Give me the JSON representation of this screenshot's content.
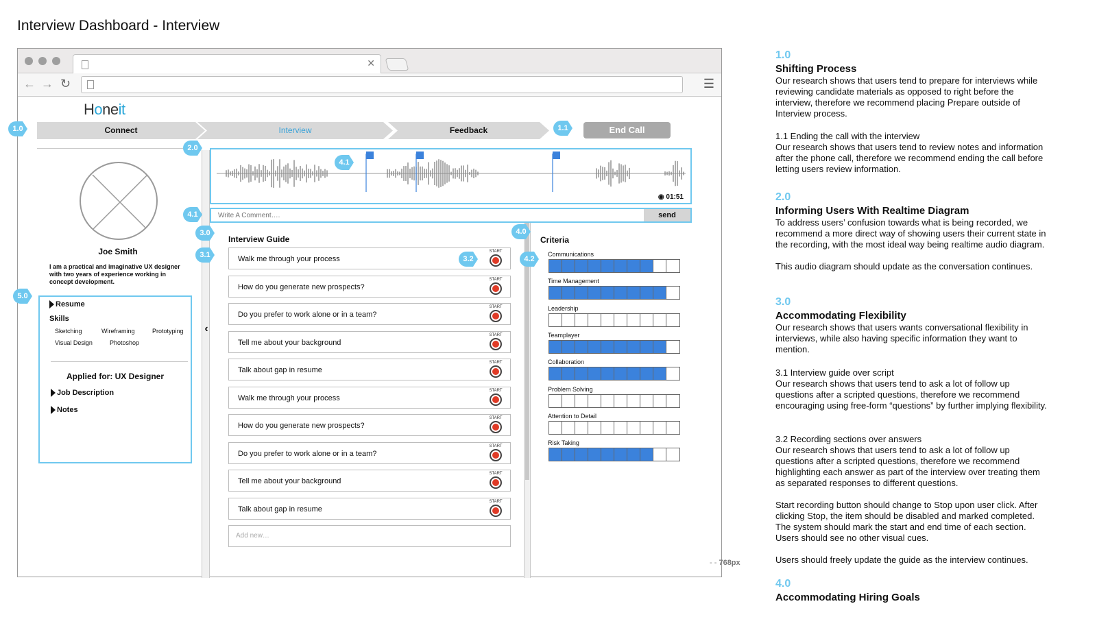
{
  "page": {
    "title": "Interview Dashboard - Interview"
  },
  "app": {
    "logo_pre": "H",
    "logo_o": "o",
    "logo_ne": "ne",
    "logo_it": "it"
  },
  "steps": {
    "connect": "Connect",
    "interview": "Interview",
    "feedback": "Feedback",
    "end_call": "End Call"
  },
  "badges": {
    "b1_0": "1.0",
    "b1_1": "1.1",
    "b2_0": "2.0",
    "b4_1a": "4.1",
    "b4_1b": "4.1",
    "b3_0": "3.0",
    "b3_1": "3.1",
    "b3_2": "3.2",
    "b4_0": "4.0",
    "b4_2": "4.2",
    "b5_0": "5.0"
  },
  "candidate": {
    "name": "Joe Smith",
    "bio": "I am a practical and imaginative UX designer with two years of experience working in concept development.",
    "resume_label": "Resume",
    "skills_label": "Skills",
    "skills": [
      "Sketching",
      "Wireframing",
      "Prototyping",
      "Visual Design",
      "Photoshop"
    ],
    "applied_for": "Applied for: UX Designer",
    "job_description": "Job Description",
    "notes": "Notes"
  },
  "audio": {
    "time": "01:51",
    "rec_dot": "◉"
  },
  "comment": {
    "placeholder": "Write A Comment….",
    "send": "send"
  },
  "guide": {
    "title": "Interview Guide",
    "start_label": "START",
    "questions": [
      "Walk me through your process",
      "How do you generate new prospects?",
      "Do you prefer to work alone or in a team?",
      "Tell me about your background",
      "Talk about gap in resume",
      "Walk me through your process",
      "How do you generate new prospects?",
      "Do you prefer to work alone or in a team?",
      "Tell me about your background",
      "Talk about gap in resume"
    ],
    "add_new": "Add new…"
  },
  "criteria": {
    "title": "Criteria",
    "items": [
      {
        "label": "Communications",
        "filled": 8
      },
      {
        "label": "Time Management",
        "filled": 9
      },
      {
        "label": "Leadership",
        "filled": 0
      },
      {
        "label": "Teamplayer",
        "filled": 9
      },
      {
        "label": "Collaboration",
        "filled": 9
      },
      {
        "label": "Problem Solving",
        "filled": 0
      },
      {
        "label": "Attention to Detail",
        "filled": 0
      },
      {
        "label": "Risk Taking",
        "filled": 8
      }
    ],
    "total_cells": 10,
    "fill_color": "#3b82dc"
  },
  "ruler": {
    "label": "768px",
    "dashes": "- -"
  },
  "accent_color": "#6fc8ef",
  "notes": {
    "n1_num": "1.0",
    "n1_title": "Shifting Process",
    "n1_body": "Our research shows that users tend to prepare for interviews while reviewing candidate materials as opposed to right before the interview, therefore we recommend placing Prepare outside of Interview process.",
    "n11_title": "1.1 Ending the call with the interview",
    "n11_body": "Our research shows that users tend to review notes and information after the phone call, therefore we recommend ending the call before letting users review information.",
    "n2_num": "2.0",
    "n2_title": "Informing Users With Realtime Diagram",
    "n2_body": "To address users’ confusion towards what is being recorded, we recommend a more direct way of showing users their current state in the recording, with the most ideal way being realtime audio diagram.",
    "n2_body2": "This audio diagram should update as the conversation continues.",
    "n3_num": "3.0",
    "n3_title": "Accommodating Flexibility",
    "n3_body": "Our research shows that users wants conversational flexibility in interviews, while also having specific information they want to mention.",
    "n31_title": "3.1 Interview guide over script",
    "n31_body": "Our research shows that users tend to ask a lot of follow up questions after a scripted questions, therefore we recommend encouraging using free-form “questions” by further implying flexibility.",
    "n32_title": "3.2 Recording sections over answers",
    "n32_body": "Our research shows that users tend to ask a lot of follow up questions after a scripted questions, therefore we recommend highlighting each answer as part of the interview over treating them as separated responses to different questions.",
    "n32_body2": "Start recording button should change to Stop upon user click. After clicking Stop, the item should be disabled and marked completed. The system should mark the start and end time of each section. Users should see no other visual cues.",
    "n32_body3": "Users should freely update the guide as the interview continues.",
    "n4_num": "4.0",
    "n4_title": "Accommodating Hiring Goals"
  }
}
